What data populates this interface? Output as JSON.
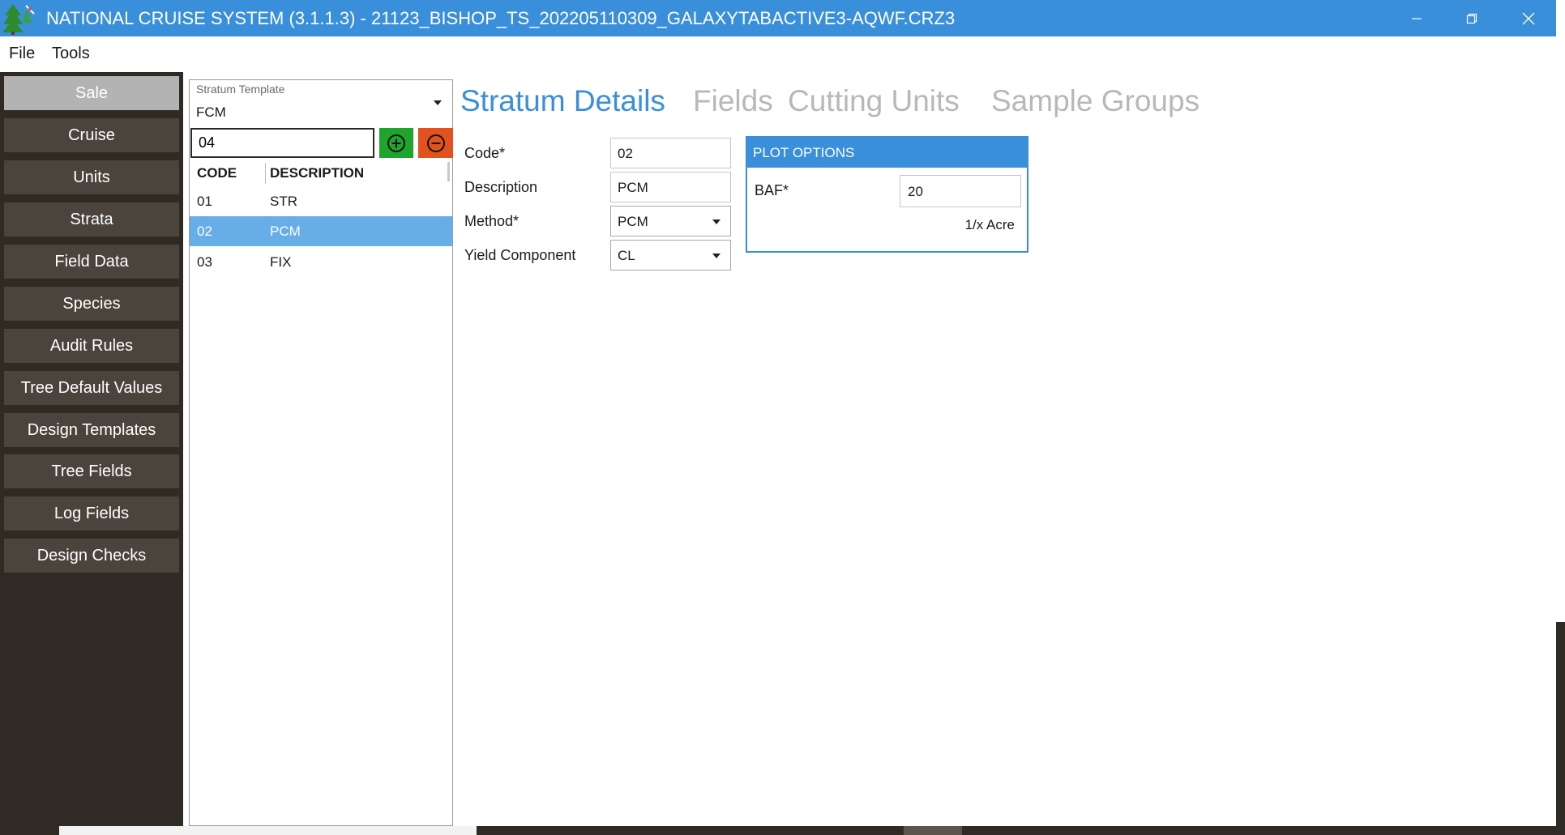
{
  "window": {
    "title": "NATIONAL CRUISE SYSTEM (3.1.1.3)  - 21123_BISHOP_TS_202205110309_GALAXYTABACTIVE3-AQWF.CRZ3",
    "app_icon": "tree-app-icon",
    "controls": {
      "minimize_icon": "minimize-icon",
      "restore_icon": "restore-icon",
      "close_icon": "close-icon"
    },
    "accent_color": "#3a8fdb"
  },
  "menu": {
    "file": "File",
    "tools": "Tools"
  },
  "sidebar": {
    "items": [
      {
        "label": "Sale",
        "active": true
      },
      {
        "label": "Cruise"
      },
      {
        "label": "Units"
      },
      {
        "label": "Strata"
      },
      {
        "label": "Field Data"
      },
      {
        "label": "Species"
      },
      {
        "label": "Audit Rules"
      },
      {
        "label": "Tree Default Values"
      },
      {
        "label": "Design Templates"
      },
      {
        "label": "Tree Fields"
      },
      {
        "label": "Log Fields"
      },
      {
        "label": "Design Checks"
      }
    ]
  },
  "strata_list": {
    "template_label": "Stratum Template",
    "template_value": "FCM",
    "new_code_value": "04",
    "add_icon": "plus-circle-icon",
    "remove_icon": "minus-circle-icon",
    "columns": {
      "code": "CODE",
      "description": "DESCRIPTION"
    },
    "rows": [
      {
        "code": "01",
        "description": "STR"
      },
      {
        "code": "02",
        "description": "PCM",
        "selected": true
      },
      {
        "code": "03",
        "description": "FIX"
      }
    ]
  },
  "tabs": {
    "stratum_details": "Stratum Details",
    "fields": "Fields",
    "cutting_units": "Cutting Units",
    "sample_groups": "Sample Groups"
  },
  "details": {
    "code_label": "Code*",
    "code_value": "02",
    "description_label": "Description",
    "description_value": "PCM",
    "method_label": "Method*",
    "method_value": "PCM",
    "yield_label": "Yield Component",
    "yield_value": "CL"
  },
  "plot_options": {
    "title": "PLOT OPTIONS",
    "baf_label": "BAF*",
    "baf_value": "20",
    "unit_label": "1/x Acre"
  }
}
